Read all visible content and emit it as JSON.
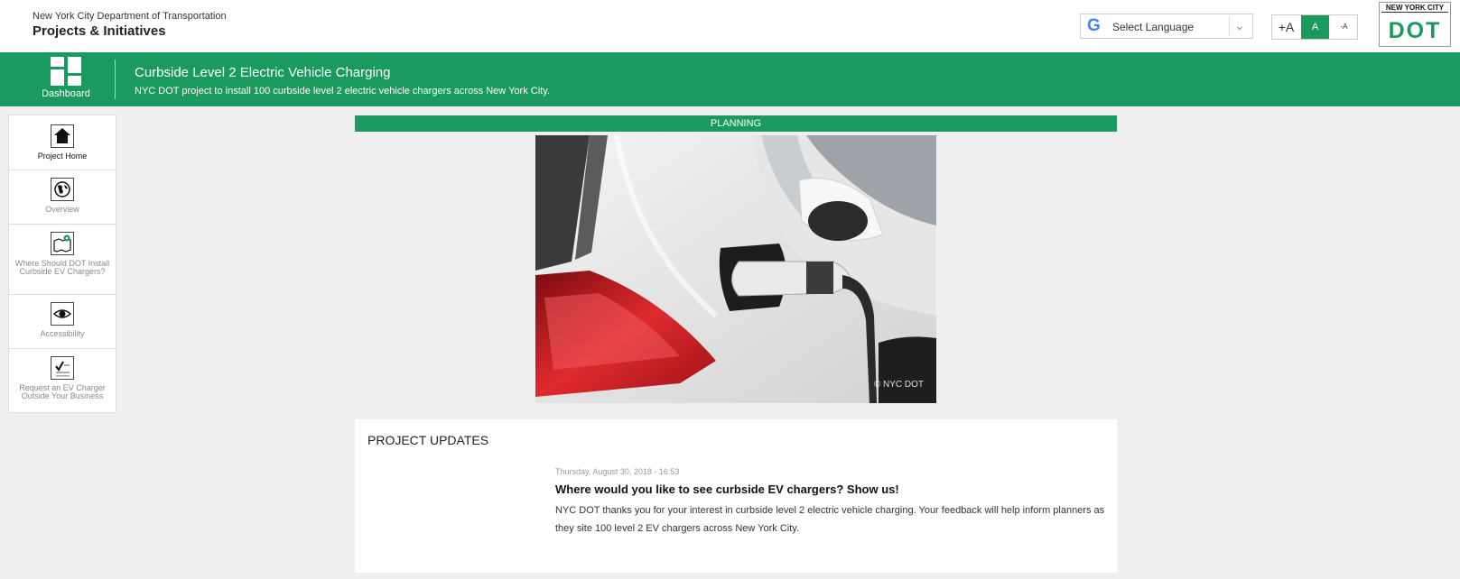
{
  "header": {
    "org": "New York City Department of Transportation",
    "section": "Projects & Initiatives",
    "language_label": "Select Language",
    "font_controls": [
      "+A",
      "A",
      "-A"
    ],
    "logo_top": "NEW YORK CITY",
    "logo_main": "DOT"
  },
  "project": {
    "dashboard_label": "Dashboard",
    "title": "Curbside Level 2 Electric Vehicle Charging",
    "description": "NYC DOT project to install 100 curbside level 2 electric vehicle chargers across New York City."
  },
  "sidebar": {
    "items": [
      {
        "label": "Project Home",
        "icon": "house-icon"
      },
      {
        "label": "Overview",
        "icon": "globe-icon"
      },
      {
        "label": "Where Should DOT Install Curbside EV Chargers?",
        "icon": "map-pin-icon"
      },
      {
        "label": "Accessibility",
        "icon": "eye-icon"
      },
      {
        "label": "Request an EV Charger Outside Your Business",
        "icon": "checklist-icon"
      }
    ]
  },
  "main": {
    "status": "PLANNING",
    "photo_credit": "© NYC DOT",
    "updates": {
      "heading": "PROJECT UPDATES",
      "date": "Thursday, August 30, 2018 - 16:53",
      "title": "Where would you like to see curbside EV chargers? Show us!",
      "body": "NYC DOT thanks you for your interest in curbside level 2 electric vehicle charging. Your feedback will help inform planners as they site 100 level 2 EV chargers across New York City."
    }
  },
  "colors": {
    "brand_green": "#1a9a5e",
    "page_bg": "#efefef"
  }
}
